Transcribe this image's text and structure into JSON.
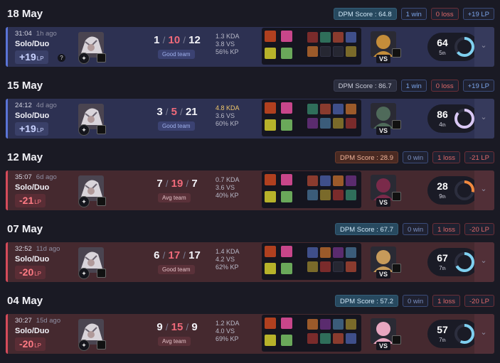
{
  "days": [
    {
      "date": "18 May",
      "dpm": "DPM Score : 64.8",
      "dpm_tone": "good",
      "win": "1 win",
      "loss": "0 loss",
      "lp": "+19 LP",
      "lp_pos": true,
      "match": {
        "result": "win",
        "time": "31:04",
        "ago": "1h ago",
        "queue": "Solo/Duo",
        "lp_num": "+19",
        "lp_unit": "LP",
        "show_help": true,
        "k": "1",
        "d": "10",
        "a": "12",
        "tag": "Good team",
        "kda": "1.3 KDA",
        "vs": "3.8 VS",
        "kp": "56% KP",
        "kda_hi": false,
        "score": "64",
        "rank": "5",
        "rank_suffix": "th",
        "ring_pct": 0.64,
        "ring_color": "#7fd0f0",
        "opp_color": "#c48d3a",
        "empty_items": [
          1,
          2
        ]
      }
    },
    {
      "date": "15 May",
      "dpm": "DPM Score : 86.7",
      "dpm_tone": "neutral",
      "win": "1 win",
      "loss": "0 loss",
      "lp": "+19 LP",
      "lp_pos": true,
      "match": {
        "result": "win",
        "time": "24:12",
        "ago": "4d ago",
        "queue": "Solo/Duo",
        "lp_num": "+19",
        "lp_unit": "LP",
        "show_help": false,
        "k": "3",
        "d": "5",
        "a": "21",
        "tag": "Good team",
        "kda": "4.8 KDA",
        "vs": "3.6 VS",
        "kp": "60% KP",
        "kda_hi": true,
        "score": "86",
        "rank": "4",
        "rank_suffix": "th",
        "ring_pct": 0.86,
        "ring_color": "#d9c8f5",
        "opp_color": "#4f6a5a",
        "empty_items": []
      }
    },
    {
      "date": "12 May",
      "dpm": "DPM Score : 28.9",
      "dpm_tone": "bad",
      "win": "0 win",
      "loss": "1 loss",
      "lp": "-21 LP",
      "lp_pos": false,
      "match": {
        "result": "loss",
        "time": "35:07",
        "ago": "6d ago",
        "queue": "Solo/Duo",
        "lp_num": "-21",
        "lp_unit": "LP",
        "show_help": false,
        "k": "7",
        "d": "19",
        "a": "7",
        "tag": "Avg team",
        "kda": "0.7 KDA",
        "vs": "3.6 VS",
        "kp": "40% KP",
        "kda_hi": false,
        "score": "28",
        "rank": "9",
        "rank_suffix": "th",
        "ring_pct": 0.28,
        "ring_color": "#f0883e",
        "opp_color": "#7a2a4a",
        "empty_items": []
      }
    },
    {
      "date": "07 May",
      "dpm": "DPM Score : 67.7",
      "dpm_tone": "good",
      "win": "0 win",
      "loss": "1 loss",
      "lp": "-20 LP",
      "lp_pos": false,
      "match": {
        "result": "loss",
        "time": "32:52",
        "ago": "11d ago",
        "queue": "Solo/Duo",
        "lp_num": "-20",
        "lp_unit": "LP",
        "show_help": false,
        "k": "6",
        "d": "17",
        "a": "17",
        "tag": "Good team",
        "kda": "1.4 KDA",
        "vs": "4.2 VS",
        "kp": "62% KP",
        "kda_hi": false,
        "score": "67",
        "rank": "7",
        "rank_suffix": "th",
        "ring_pct": 0.67,
        "ring_color": "#7fd0f0",
        "opp_color": "#c69a5a",
        "empty_items": [
          2
        ]
      }
    },
    {
      "date": "04 May",
      "dpm": "DPM Score : 57.2",
      "dpm_tone": "good",
      "win": "0 win",
      "loss": "1 loss",
      "lp": "-20 LP",
      "lp_pos": false,
      "match": {
        "result": "loss",
        "time": "30:27",
        "ago": "15d ago",
        "queue": "Solo/Duo",
        "lp_num": "-20",
        "lp_unit": "LP",
        "show_help": false,
        "k": "9",
        "d": "15",
        "a": "9",
        "tag": "Avg team",
        "kda": "1.2 KDA",
        "vs": "4.0 VS",
        "kp": "69% KP",
        "kda_hi": false,
        "score": "57",
        "rank": "7",
        "rank_suffix": "th",
        "ring_pct": 0.57,
        "ring_color": "#7fd0f0",
        "opp_color": "#e8a6c0",
        "empty_items": []
      }
    }
  ],
  "vs_label": "VS",
  "help_label": "?",
  "icons": {
    "role": "top-lane-icon",
    "expand": "chevron-down-icon",
    "champion": "champion-portrait-icon"
  }
}
